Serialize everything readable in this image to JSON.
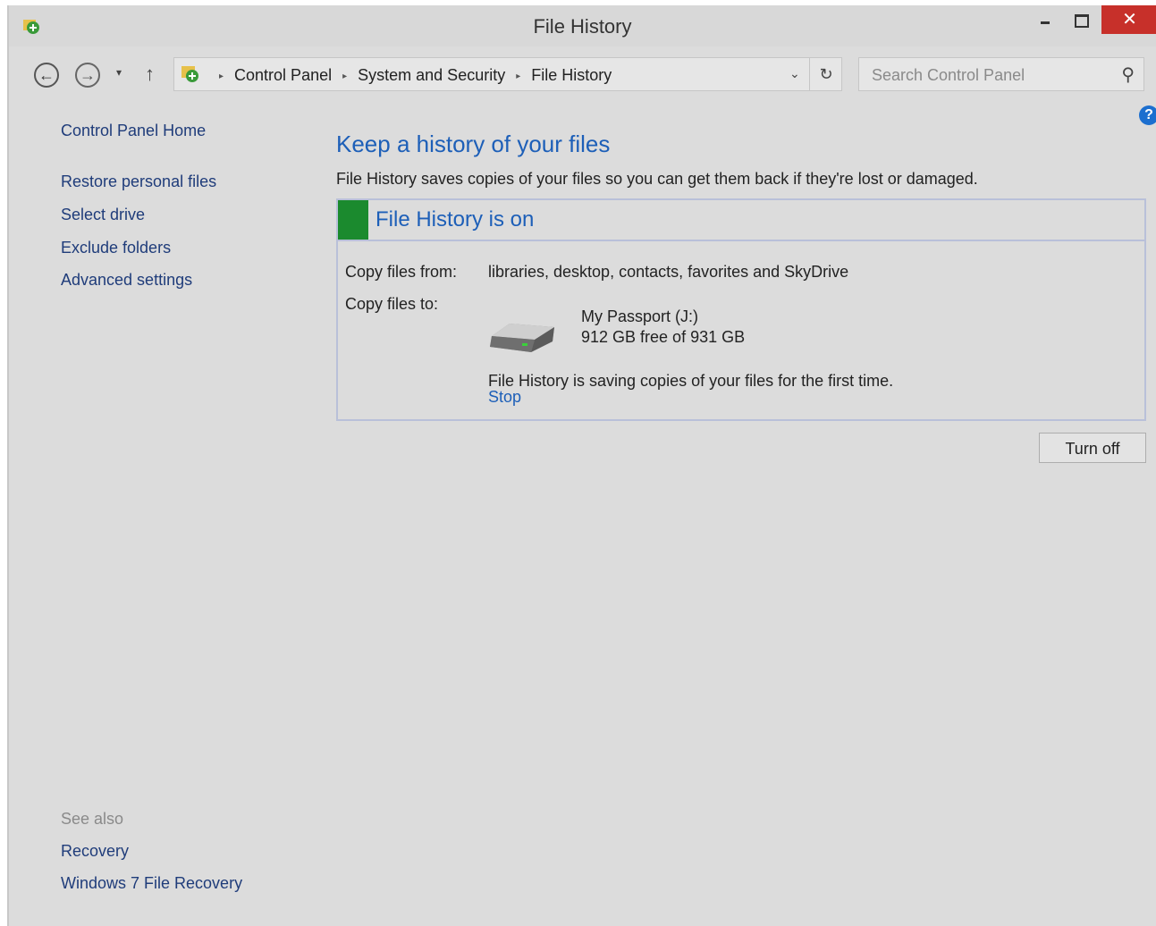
{
  "window": {
    "title": "File History",
    "close_glyph": "✕"
  },
  "nav": {
    "back_glyph": "←",
    "forward_glyph": "→",
    "dropdown_glyph": "▾",
    "up_glyph": "↑",
    "breadcrumbs": [
      "Control Panel",
      "System and Security",
      "File History"
    ],
    "breadcrumb_sep": "▸",
    "address_dropdown_glyph": "⌄",
    "refresh_glyph": "↻",
    "search_placeholder": "Search Control Panel",
    "search_glyph": "⚲"
  },
  "sidebar": {
    "home": "Control Panel Home",
    "items": [
      "Restore personal files",
      "Select drive",
      "Exclude folders",
      "Advanced settings"
    ],
    "see_also_label": "See also",
    "see_also": [
      "Recovery",
      "Windows 7 File Recovery"
    ]
  },
  "help_glyph": "?",
  "main": {
    "title": "Keep a history of your files",
    "description": "File History saves copies of your files so you can get them back if they're lost or damaged.",
    "status": {
      "text": "File History is on",
      "accent_color": "#1b8a2e",
      "copy_from_label": "Copy files from:",
      "copy_from_value": "libraries, desktop, contacts, favorites and SkyDrive",
      "copy_to_label": "Copy files to:",
      "drive_name": "My Passport (J:)",
      "drive_space": "912 GB free of 931 GB",
      "progress_message": "File History is saving copies of your files for the first time.",
      "stop_label": "Stop"
    },
    "turn_off_label": "Turn off"
  }
}
